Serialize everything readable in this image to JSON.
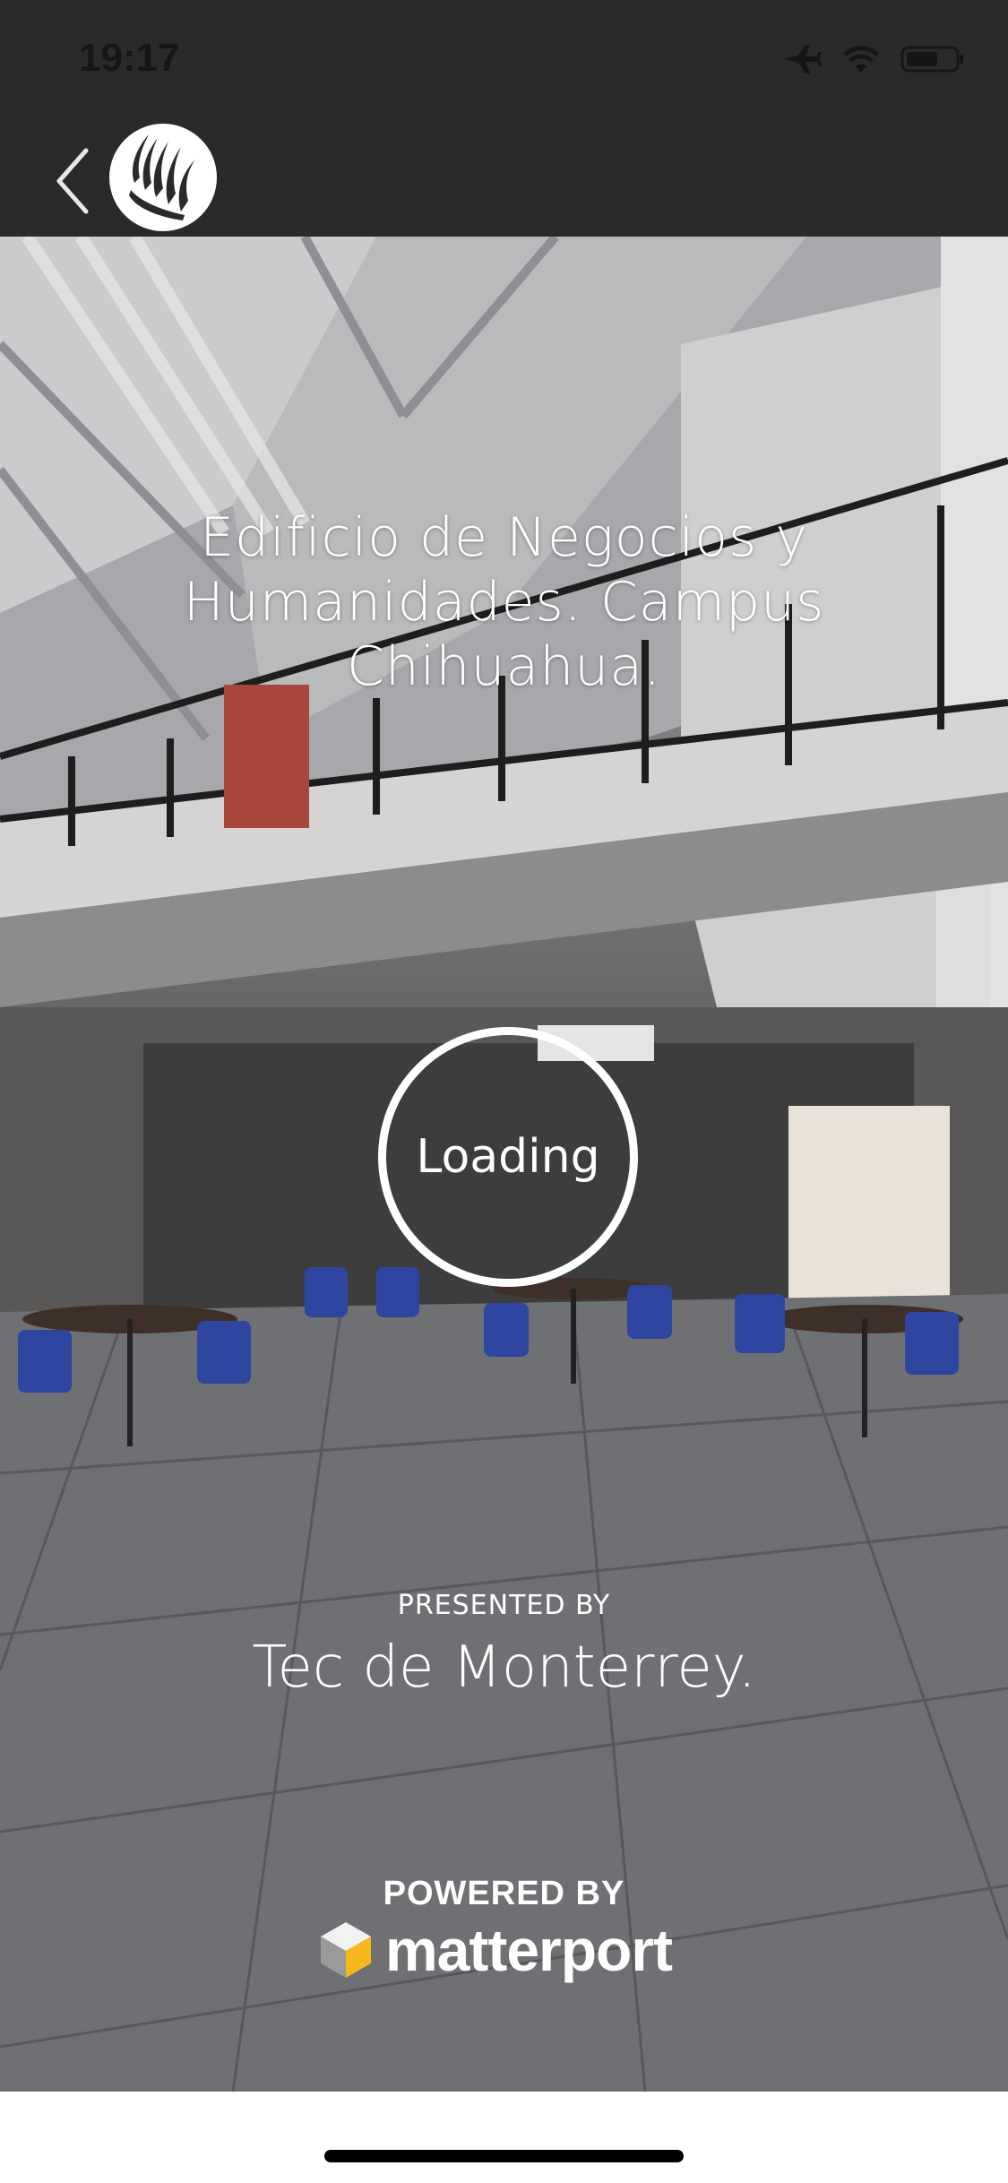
{
  "status_bar": {
    "time": "19:17",
    "icons": [
      "airplane-icon",
      "wifi-icon",
      "battery-icon"
    ]
  },
  "nav": {
    "back_icon": "chevron-left-icon",
    "logo_icon": "tec-monterrey-logo"
  },
  "tour": {
    "title": "Edificio de Negocios y Humanidades. Campus Chihuahua.",
    "loading_label": "Loading",
    "presented_by_label": "PRESENTED BY",
    "presenter": "Tec de Monterrey.",
    "powered_by_label": "POWERED BY",
    "brand": "matterport"
  },
  "colors": {
    "bar_background": "#2a2a2a",
    "text": "#ffffff",
    "home_indicator": "#000000"
  }
}
